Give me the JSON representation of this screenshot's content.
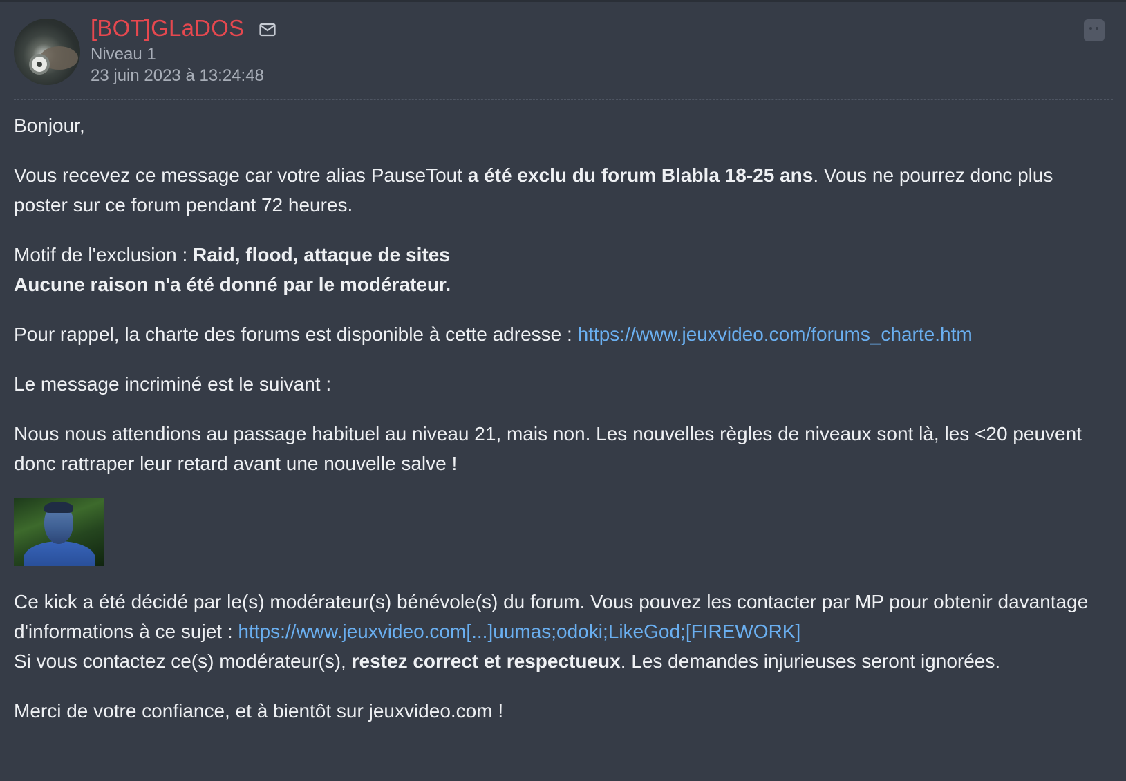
{
  "post": {
    "author": "[BOT]GLaDOS",
    "level": "Niveau 1",
    "date": "23 juin 2023 à 13:24:48"
  },
  "message": {
    "greeting": "Bonjour,",
    "p1_a": "Vous recevez ce message car votre alias PauseTout ",
    "p1_b": "a été exclu du forum Blabla 18-25 ans",
    "p1_c": ". Vous ne pourrez donc plus poster sur ce forum pendant 72 heures.",
    "reason_label": "Motif de l'exclusion : ",
    "reason_value": "Raid, flood, attaque de sites",
    "no_reason": "Aucune raison n'a été donné par le modérateur.",
    "charter_text": "Pour rappel, la charte des forums est disponible à cette adresse : ",
    "charter_link": "https://www.jeuxvideo.com/forums_charte.htm",
    "incriminated_intro": "Le message incriminé est le suivant :",
    "incriminated_message": "Nous nous attendions au passage habituel au niveau 21, mais non. Les nouvelles règles de niveaux sont là, les <20 peuvent donc rattraper leur retard avant une nouvelle salve !",
    "kick_text": "Ce kick a été décidé par le(s) modérateur(s) bénévole(s) du forum. Vous pouvez les contacter par MP pour obtenir davantage d'informations à ce sujet : ",
    "kick_link": "https://www.jeuxvideo.com[...]uumas;odoki;LikeGod;[FIREWORK]",
    "contact_a": "Si vous contactez ce(s) modérateur(s), ",
    "contact_b": "restez correct et respectueux",
    "contact_c": ". Les demandes injurieuses seront ignorées.",
    "closing": "Merci de votre confiance, et à bientôt sur jeuxvideo.com !"
  },
  "icons": {
    "mail": "mail-icon",
    "side": "sticker-icon",
    "avatar": "avatar"
  },
  "colors": {
    "background": "#363c47",
    "author": "#e6484f",
    "meta": "#a8aeb8",
    "link": "#6aaff0",
    "text": "#eef0f3"
  }
}
